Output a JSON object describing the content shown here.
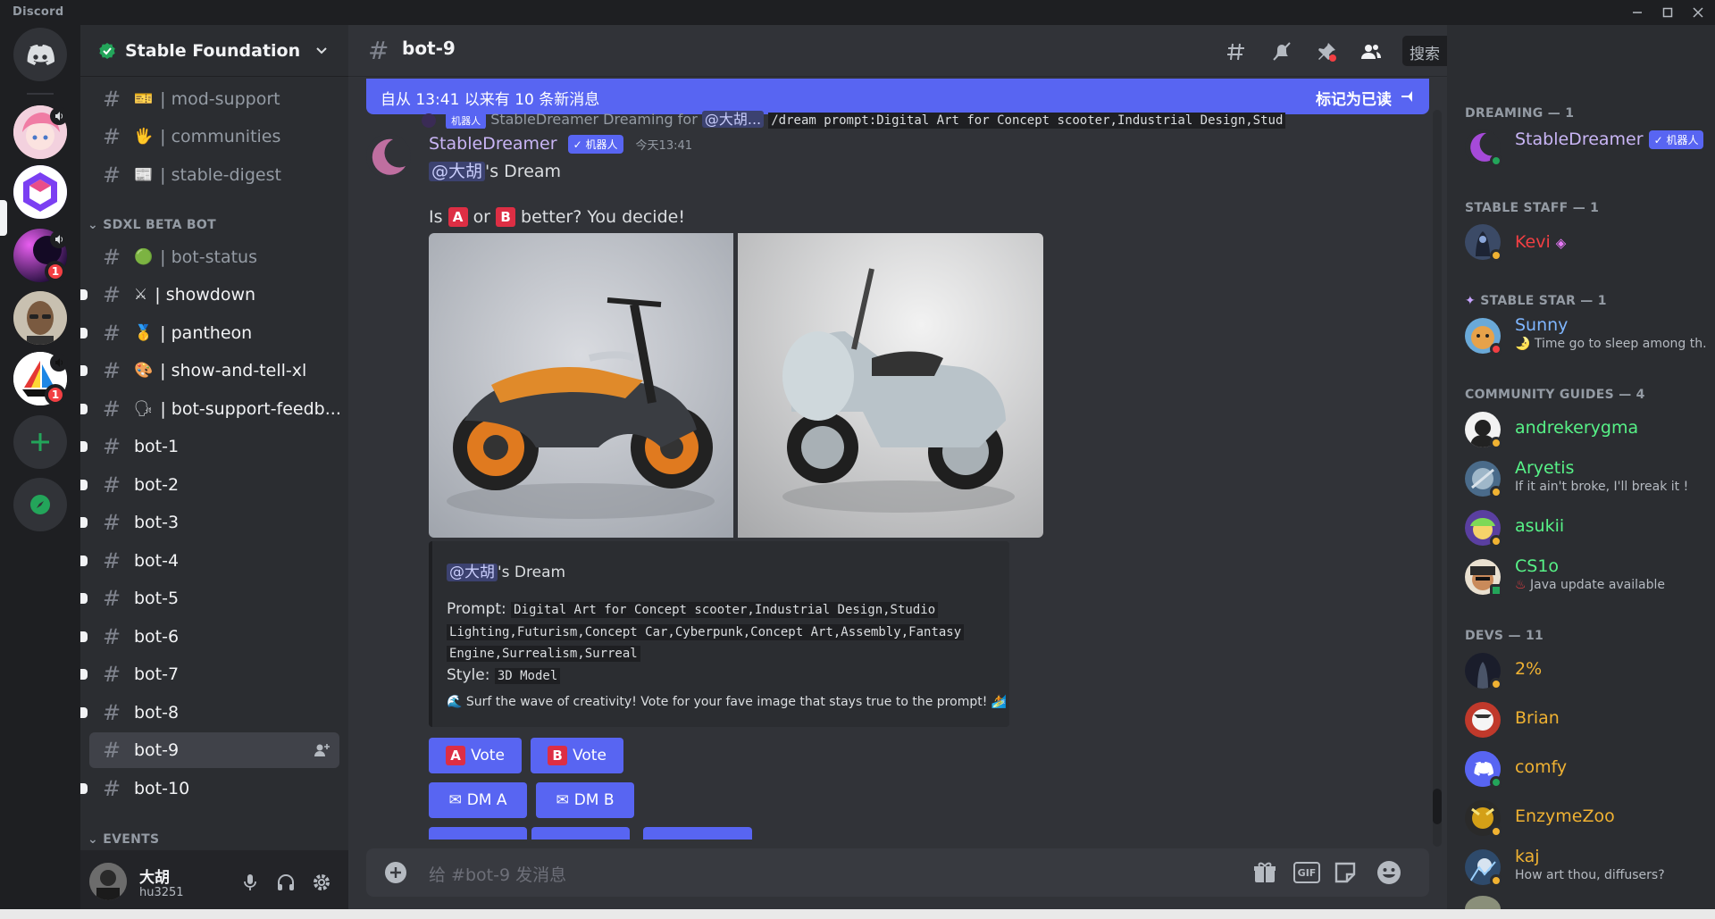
{
  "app": {
    "title": "Discord"
  },
  "colors": {
    "accent": "#5865f2",
    "online": "#23a55a",
    "idle": "#f0b232",
    "dnd": "#f23f43",
    "mod": "#f23f43",
    "dev": "#f0b232",
    "guide": "#57f287"
  },
  "servers": {
    "badges": [
      "1",
      "1"
    ],
    "icons": [
      "discord-home-icon",
      "add-server-icon",
      "explore-icon"
    ]
  },
  "guild": {
    "name": "Stable Foundation"
  },
  "channels": {
    "top": [
      {
        "emoji": "🎫",
        "name": "| mod-support"
      },
      {
        "emoji": "🖐",
        "name": "| communities"
      },
      {
        "emoji": "📰",
        "name": "| stable-digest"
      }
    ],
    "category_sdxl": "SDXL BETA BOT",
    "sdxl": [
      {
        "emoji": "🟢",
        "name": "| bot-status"
      },
      {
        "emoji": "⚔",
        "name": "| showdown"
      },
      {
        "emoji": "🥇",
        "name": "| pantheon"
      },
      {
        "emoji": "🎨",
        "name": "| show-and-tell-xl"
      },
      {
        "emoji": "🗣",
        "name": "| bot-support-feedb..."
      },
      {
        "emoji": "",
        "name": "bot-1"
      },
      {
        "emoji": "",
        "name": "bot-2"
      },
      {
        "emoji": "",
        "name": "bot-3"
      },
      {
        "emoji": "",
        "name": "bot-4"
      },
      {
        "emoji": "",
        "name": "bot-5"
      },
      {
        "emoji": "",
        "name": "bot-6"
      },
      {
        "emoji": "",
        "name": "bot-7"
      },
      {
        "emoji": "",
        "name": "bot-8"
      },
      {
        "emoji": "",
        "name": "bot-9"
      },
      {
        "emoji": "",
        "name": "bot-10"
      }
    ],
    "category_events": "EVENTS"
  },
  "user": {
    "name": "大胡",
    "tag": "hu3251"
  },
  "chat": {
    "channel": "bot-9",
    "search_placeholder": "搜索",
    "new_messages": "自从 13:41 以来有 10 条新消息",
    "mark_read": "标记为已读",
    "reply_preview": {
      "bot_tag": "机器人",
      "author": "StableDreamer",
      "text": "Dreaming for",
      "mention": "@大胡...",
      "command": "/dream prompt:Digital Art for Concept scooter,Industrial Design,Stud"
    },
    "message": {
      "author": "StableDreamer",
      "bot_tag": "机器人",
      "time": "今天13:41",
      "mention": "@大胡",
      "dream_suffix": "'s Dream",
      "line2_pre": "Is",
      "letter_a": "A",
      "or": "or",
      "letter_b": "B",
      "line2_post": "better? You decide!"
    },
    "embed": {
      "mention": "@大胡",
      "title_suffix": "'s Dream",
      "prompt_label": "Prompt:",
      "prompt_lines": [
        "Digital Art for Concept scooter,Industrial Design,Studio",
        "Lighting,Futurism,Concept Car,Cyberpunk,Concept Art,Assembly,Fantasy",
        "Engine,Surrealism,Surreal"
      ],
      "style_label": "Style:",
      "style_value": "3D Model",
      "footer": "Surf the wave of creativity! Vote for your fave image that stays true to the prompt!"
    },
    "buttons": {
      "vote_a": "Vote",
      "vote_b": "Vote",
      "dm_a": "DM A",
      "dm_b": "DM B",
      "a": "A",
      "b": "B"
    },
    "composer_placeholder": "给 #bot-9 发消息",
    "gif": "GIF"
  },
  "members": {
    "cat_dreaming": "DREAMING — 1",
    "cat_staff": "STABLE STAFF — 1",
    "cat_star": "STABLE STAR — 1",
    "cat_guides": "COMMUNITY GUIDES — 4",
    "cat_devs": "DEVS — 11",
    "bot_tag": "机器人",
    "list": [
      {
        "name": "StableDreamer",
        "status": ""
      },
      {
        "name": "Kevi",
        "status": ""
      },
      {
        "name": "Sunny",
        "status": "Time go to sleep among th..."
      },
      {
        "name": "andrekerygma",
        "status": ""
      },
      {
        "name": "Aryetis",
        "status": "If it ain't broke, I'll break it !"
      },
      {
        "name": "asukii",
        "status": ""
      },
      {
        "name": "CS1o",
        "status": "Java update available"
      },
      {
        "name": "2%",
        "status": ""
      },
      {
        "name": "Brian",
        "status": ""
      },
      {
        "name": "comfy",
        "status": ""
      },
      {
        "name": "EnzymeZoo",
        "status": ""
      },
      {
        "name": "kaj",
        "status": "How art thou, diffusers?"
      }
    ]
  }
}
